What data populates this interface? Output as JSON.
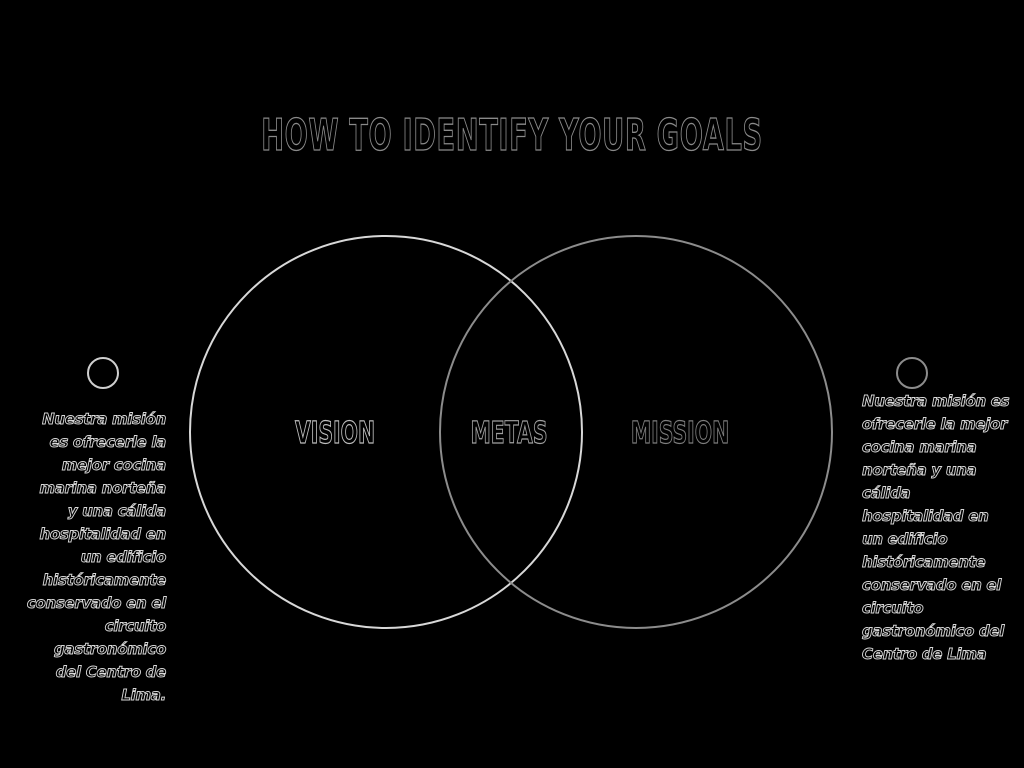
{
  "title": "HOW TO IDENTIFY YOUR GOALS",
  "venn": {
    "left_label": "VISION",
    "center_label": "METAS",
    "right_label": "MISSION",
    "colors": {
      "left_circle": "#d8d8d8",
      "right_circle": "#8c8c8c",
      "background": "#000000"
    }
  },
  "side_notes": {
    "left": "Nuestra misión es ofrecerle la mejor cocina marina norteña y una cálida hospitalidad en un edificio históricamente conservado en el circuito gastronómico del Centro de Lima.",
    "right": "Nuestra misión es ofrecerle la mejor cocina marina norteña y una cálida hospitalidad en un edificio históricamente conservado en el circuito gastronómico del Centro de Lima"
  }
}
